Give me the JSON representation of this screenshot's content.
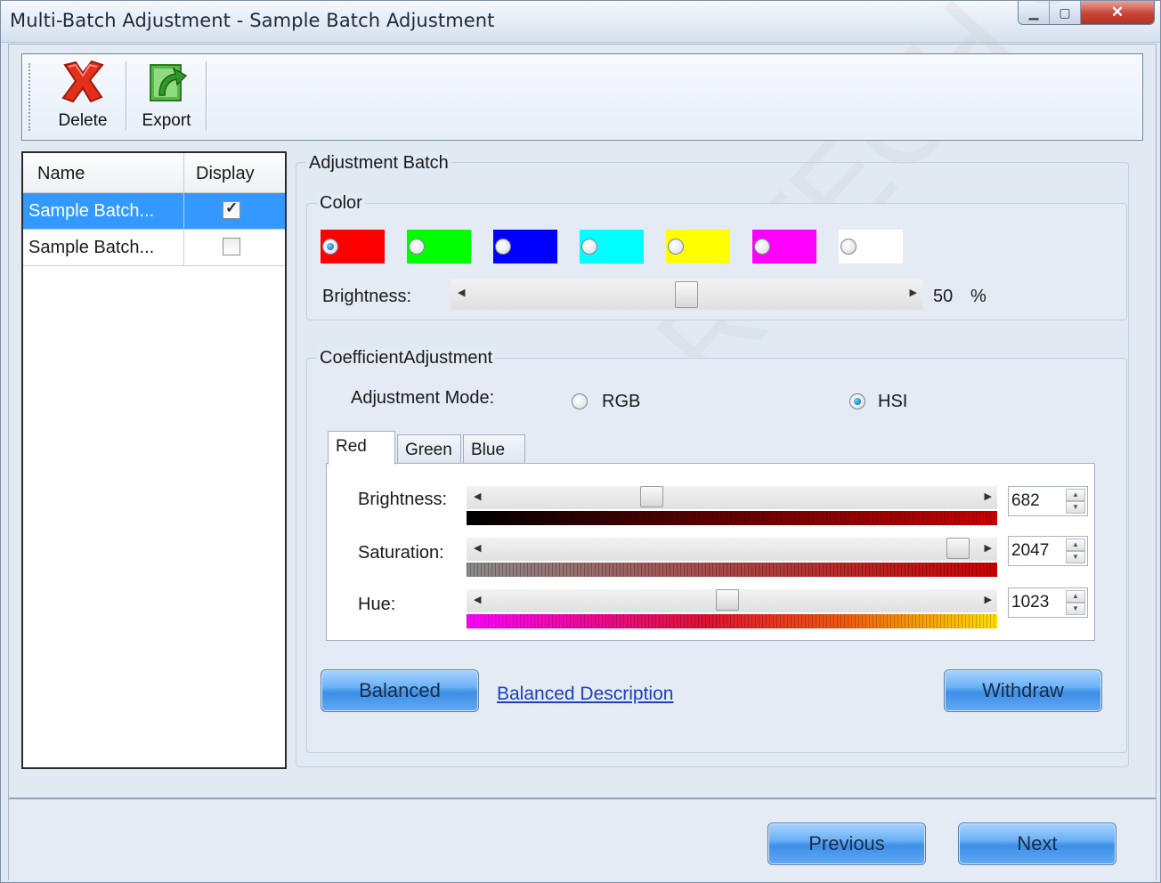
{
  "window": {
    "title": "Multi-Batch Adjustment - Sample Batch Adjustment",
    "controls": [
      "minimize",
      "maximize",
      "close"
    ]
  },
  "toolbar": {
    "delete_label": "Delete",
    "export_label": "Export"
  },
  "batch_list": {
    "col_name": "Name",
    "col_display": "Display",
    "rows": [
      {
        "name": "Sample Batch...",
        "display": true,
        "selected": true
      },
      {
        "name": "Sample Batch...",
        "display": false,
        "selected": false
      }
    ]
  },
  "adjustment_batch": {
    "title": "Adjustment Batch",
    "color_group": {
      "title": "Color",
      "swatches": [
        {
          "name": "red",
          "hex": "#ff0000",
          "selected": true
        },
        {
          "name": "green",
          "hex": "#00ff00",
          "selected": false
        },
        {
          "name": "blue",
          "hex": "#0000ff",
          "selected": false
        },
        {
          "name": "cyan",
          "hex": "#00ffff",
          "selected": false
        },
        {
          "name": "yellow",
          "hex": "#ffff00",
          "selected": false
        },
        {
          "name": "magenta",
          "hex": "#ff00ff",
          "selected": false
        },
        {
          "name": "white",
          "hex": "#ffffff",
          "selected": false
        }
      ],
      "brightness_label": "Brightness:",
      "brightness_value": "50",
      "brightness_unit": "%"
    },
    "coefficient": {
      "title": "CoefficientAdjustment",
      "mode_label": "Adjustment Mode:",
      "mode_rgb": "RGB",
      "mode_hsi": "HSI",
      "selected_mode": "HSI",
      "tabs": [
        "Red",
        "Green",
        "Blue"
      ],
      "active_tab": "Red",
      "sliders": [
        {
          "label": "Brightness:",
          "value": "682",
          "level": 0.33
        },
        {
          "label": "Saturation:",
          "value": "2047",
          "level": 0.98
        },
        {
          "label": "Hue:",
          "value": "1023",
          "level": 0.49
        }
      ]
    },
    "balanced_label": "Balanced",
    "balanced_desc_label": "Balanced Description",
    "withdraw_label": "Withdraw"
  },
  "footer": {
    "previous_label": "Previous",
    "next_label": "Next"
  },
  "watermark": "STAR TECH CO., L"
}
